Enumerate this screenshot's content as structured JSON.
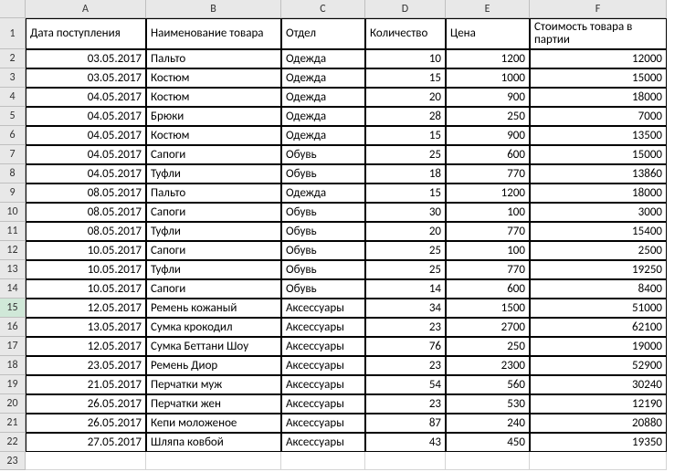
{
  "columns": [
    "A",
    "B",
    "C",
    "D",
    "E",
    "F"
  ],
  "headers": {
    "A": "Дата поступления",
    "B": "Наименование товара",
    "C": "Отдел",
    "D": "Количество",
    "E": "Цена",
    "F": "Стоимость товара в партии"
  },
  "rows": [
    {
      "n": "2",
      "A": "03.05.2017",
      "B": "Пальто",
      "C": "Одежда",
      "D": "10",
      "E": "1200",
      "F": "12000"
    },
    {
      "n": "3",
      "A": "03.05.2017",
      "B": "Костюм",
      "C": "Одежда",
      "D": "15",
      "E": "1000",
      "F": "15000"
    },
    {
      "n": "4",
      "A": "04.05.2017",
      "B": "Костюм",
      "C": "Одежда",
      "D": "20",
      "E": "900",
      "F": "18000"
    },
    {
      "n": "5",
      "A": "04.05.2017",
      "B": "Брюки",
      "C": "Одежда",
      "D": "28",
      "E": "250",
      "F": "7000"
    },
    {
      "n": "6",
      "A": "04.05.2017",
      "B": "Костюм",
      "C": "Одежда",
      "D": "15",
      "E": "900",
      "F": "13500"
    },
    {
      "n": "7",
      "A": "04.05.2017",
      "B": "Сапоги",
      "C": "Обувь",
      "D": "25",
      "E": "600",
      "F": "15000"
    },
    {
      "n": "8",
      "A": "04.05.2017",
      "B": "Туфли",
      "C": "Обувь",
      "D": "18",
      "E": "770",
      "F": "13860"
    },
    {
      "n": "9",
      "A": "08.05.2017",
      "B": "Пальто",
      "C": "Одежда",
      "D": "15",
      "E": "1200",
      "F": "18000"
    },
    {
      "n": "10",
      "A": "08.05.2017",
      "B": "Сапоги",
      "C": "Обувь",
      "D": "30",
      "E": "100",
      "F": "3000"
    },
    {
      "n": "11",
      "A": "08.05.2017",
      "B": "Туфли",
      "C": "Обувь",
      "D": "20",
      "E": "770",
      "F": "15400"
    },
    {
      "n": "12",
      "A": "10.05.2017",
      "B": "Сапоги",
      "C": "Обувь",
      "D": "25",
      "E": "100",
      "F": "2500"
    },
    {
      "n": "13",
      "A": "10.05.2017",
      "B": "Туфли",
      "C": "Обувь",
      "D": "25",
      "E": "770",
      "F": "19250"
    },
    {
      "n": "14",
      "A": "10.05.2017",
      "B": "Сапоги",
      "C": "Обувь",
      "D": "14",
      "E": "600",
      "F": "8400"
    },
    {
      "n": "15",
      "A": "12.05.2017",
      "B": "Ремень кожаный",
      "C": "Аксессуары",
      "D": "34",
      "E": "1500",
      "F": "51000"
    },
    {
      "n": "16",
      "A": "13.05.2017",
      "B": "Сумка крокодил",
      "C": "Аксессуары",
      "D": "23",
      "E": "2700",
      "F": "62100"
    },
    {
      "n": "17",
      "A": "12.05.2017",
      "B": "Сумка Беттани Шоу",
      "C": "Аксессуары",
      "D": "76",
      "E": "250",
      "F": "19000"
    },
    {
      "n": "18",
      "A": "23.05.2017",
      "B": "Ремень Диор",
      "C": "Аксессуары",
      "D": "23",
      "E": "2300",
      "F": "52900"
    },
    {
      "n": "19",
      "A": "21.05.2017",
      "B": "Перчатки муж",
      "C": "Аксессуары",
      "D": "54",
      "E": "560",
      "F": "30240"
    },
    {
      "n": "20",
      "A": "26.05.2017",
      "B": "Перчатки жен",
      "C": "Аксессуары",
      "D": "23",
      "E": "530",
      "F": "12190"
    },
    {
      "n": "21",
      "A": "26.05.2017",
      "B": "Кепи моложеное",
      "C": "Аксессуары",
      "D": "87",
      "E": "240",
      "F": "20880"
    },
    {
      "n": "22",
      "A": "27.05.2017",
      "B": "Шляпа ковбой",
      "C": "Аксессуары",
      "D": "43",
      "E": "450",
      "F": "19350"
    }
  ],
  "selectedRow": "15",
  "extraRow": "23",
  "chart_data": {
    "type": "table",
    "title": "",
    "columns": [
      "Дата поступления",
      "Наименование товара",
      "Отдел",
      "Количество",
      "Цена",
      "Стоимость товара в партии"
    ],
    "data": [
      [
        "03.05.2017",
        "Пальто",
        "Одежда",
        10,
        1200,
        12000
      ],
      [
        "03.05.2017",
        "Костюм",
        "Одежда",
        15,
        1000,
        15000
      ],
      [
        "04.05.2017",
        "Костюм",
        "Одежда",
        20,
        900,
        18000
      ],
      [
        "04.05.2017",
        "Брюки",
        "Одежда",
        28,
        250,
        7000
      ],
      [
        "04.05.2017",
        "Костюм",
        "Одежда",
        15,
        900,
        13500
      ],
      [
        "04.05.2017",
        "Сапоги",
        "Обувь",
        25,
        600,
        15000
      ],
      [
        "04.05.2017",
        "Туфли",
        "Обувь",
        18,
        770,
        13860
      ],
      [
        "08.05.2017",
        "Пальто",
        "Одежда",
        15,
        1200,
        18000
      ],
      [
        "08.05.2017",
        "Сапоги",
        "Обувь",
        30,
        100,
        3000
      ],
      [
        "08.05.2017",
        "Туфли",
        "Обувь",
        20,
        770,
        15400
      ],
      [
        "10.05.2017",
        "Сапоги",
        "Обувь",
        25,
        100,
        2500
      ],
      [
        "10.05.2017",
        "Туфли",
        "Обувь",
        25,
        770,
        19250
      ],
      [
        "10.05.2017",
        "Сапоги",
        "Обувь",
        14,
        600,
        8400
      ],
      [
        "12.05.2017",
        "Ремень кожаный",
        "Аксессуары",
        34,
        1500,
        51000
      ],
      [
        "13.05.2017",
        "Сумка крокодил",
        "Аксессуары",
        23,
        2700,
        62100
      ],
      [
        "12.05.2017",
        "Сумка Беттани Шоу",
        "Аксессуары",
        76,
        250,
        19000
      ],
      [
        "23.05.2017",
        "Ремень Диор",
        "Аксессуары",
        23,
        2300,
        52900
      ],
      [
        "21.05.2017",
        "Перчатки муж",
        "Аксессуары",
        54,
        560,
        30240
      ],
      [
        "26.05.2017",
        "Перчатки жен",
        "Аксессуары",
        23,
        530,
        12190
      ],
      [
        "26.05.2017",
        "Кепи моложеное",
        "Аксессуары",
        87,
        240,
        20880
      ],
      [
        "27.05.2017",
        "Шляпа ковбой",
        "Аксессуары",
        43,
        450,
        19350
      ]
    ]
  }
}
